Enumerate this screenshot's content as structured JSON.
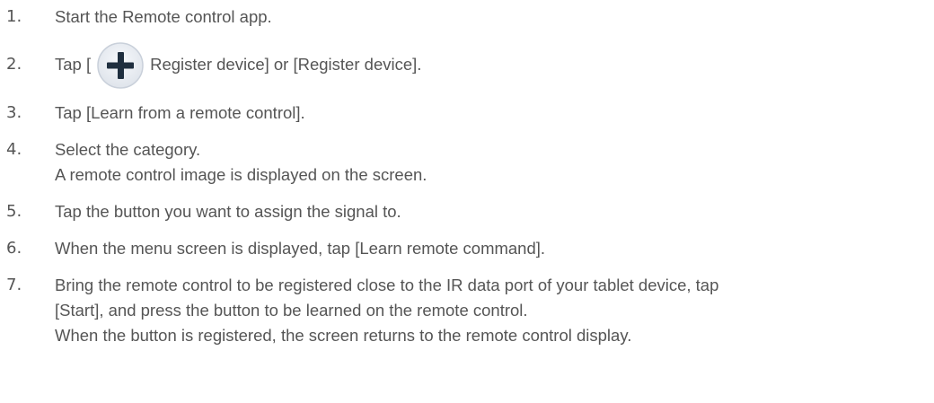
{
  "steps": [
    {
      "number": "1.",
      "lines": [
        "Start the Remote control app."
      ]
    },
    {
      "number": "2.",
      "text_before_icon": "Tap [",
      "icon": "plus-icon",
      "text_after_icon": "Register device] or [Register device]."
    },
    {
      "number": "3.",
      "lines": [
        "Tap [Learn from a remote control]."
      ]
    },
    {
      "number": "4.",
      "lines": [
        "Select the category.",
        "A remote control image is displayed on the screen."
      ]
    },
    {
      "number": "5.",
      "lines": [
        "Tap the button you want to assign the signal to."
      ]
    },
    {
      "number": "6.",
      "lines": [
        "When the menu screen is displayed, tap [Learn remote command]."
      ]
    },
    {
      "number": "7.",
      "lines": [
        "Bring the remote control to be registered close to the IR data port of your tablet device, tap",
        "[Start], and press the button to be learned on the remote control.",
        "When the button is registered, the screen returns to the remote control display."
      ]
    }
  ],
  "colors": {
    "text": "#555555",
    "icon_circle": "#e9edf3",
    "icon_ring": "#c9d0da",
    "icon_plus": "#1f2f3f"
  }
}
